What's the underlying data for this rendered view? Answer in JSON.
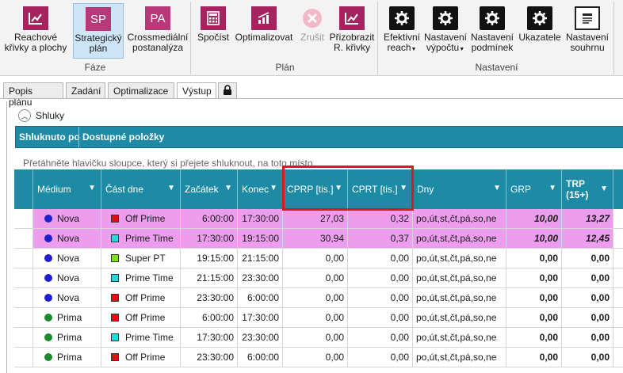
{
  "ribbon": {
    "groups": {
      "faze": {
        "label": "Fáze"
      },
      "plan": {
        "label": "Plán"
      },
      "nastaveni": {
        "label": "Nastavení"
      }
    },
    "buttons": [
      {
        "label1": "Reachové",
        "label2": "křivky a plochy",
        "icon": "chart-icon"
      },
      {
        "label1": "Strategický",
        "label2": "plán",
        "icon": "SP"
      },
      {
        "label1": "Crossmediální",
        "label2": "postanalýza",
        "icon": "PA"
      },
      {
        "label1": "Spočíst",
        "label2": "",
        "icon": "calculator-icon"
      },
      {
        "label1": "Optimalizovat",
        "label2": "",
        "icon": "optimize-chart-icon"
      },
      {
        "label1": "Zrušit",
        "label2": "",
        "icon": "cancel-icon"
      },
      {
        "label1": "Přizobrazit",
        "label2": "R. křivky",
        "icon": "curve-chart-icon"
      },
      {
        "label1": "Efektivní",
        "label2": "reach",
        "icon": "gear-icon"
      },
      {
        "label1": "Nastavení",
        "label2": "výpočtu",
        "icon": "gear-icon"
      },
      {
        "label1": "Nastavení",
        "label2": "podmínek",
        "icon": "gear-icon"
      },
      {
        "label1": "Ukazatele",
        "label2": "",
        "icon": "gear-icon"
      },
      {
        "label1": "Nastavení",
        "label2": "souhrnu",
        "icon": "document-icon"
      }
    ],
    "icon_text": {
      "sp": "SP",
      "pa": "PA"
    }
  },
  "tabs": [
    {
      "label": "Popis plánu"
    },
    {
      "label": "Zadání"
    },
    {
      "label": "Optimalizace"
    },
    {
      "label": "Výstup"
    }
  ],
  "shluky": {
    "label": "Shluky",
    "grouped_by": "Shluknuto po",
    "available": "Dostupné položky",
    "hint": "Přetáhněte hlavičku sloupce, který si přejete shluknout, na toto místo."
  },
  "columns": {
    "medium": "Médium",
    "cast_dne": "Část dne",
    "zacatek": "Začátek",
    "konec": "Konec",
    "cprp": "CPRP [tis.]",
    "cprt": "CPRT [tis.]",
    "dny": "Dny",
    "grp": "GRP",
    "trp1": "TRP",
    "trp2": "(15+)"
  },
  "colors": {
    "nova": "#1f1fd0",
    "prima": "#1a8a2a",
    "off_prime": "#e01010",
    "prime_time": "#20d8e0",
    "super_pt": "#80e020",
    "highlight": "#ec9ded"
  },
  "rows": [
    {
      "medium": "Nova",
      "mc": "#1f1fd0",
      "cast": "Off Prime",
      "cc": "#e01010",
      "start": "6:00:00",
      "end": "17:30:00",
      "cprp": "27,03",
      "cprt": "0,32",
      "dny": "po,út,st,čt,pá,so,ne",
      "grp": "10,00",
      "trp": "13,27",
      "pink": true
    },
    {
      "medium": "Nova",
      "mc": "#1f1fd0",
      "cast": "Prime Time",
      "cc": "#20d8e0",
      "start": "17:30:00",
      "end": "19:15:00",
      "cprp": "30,94",
      "cprt": "0,37",
      "dny": "po,út,st,čt,pá,so,ne",
      "grp": "10,00",
      "trp": "12,45",
      "pink": true
    },
    {
      "medium": "Nova",
      "mc": "#1f1fd0",
      "cast": "Super PT",
      "cc": "#80e020",
      "start": "19:15:00",
      "end": "21:15:00",
      "cprp": "0,00",
      "cprt": "0,00",
      "dny": "po,út,st,čt,pá,so,ne",
      "grp": "0,00",
      "trp": "0,00",
      "pink": false
    },
    {
      "medium": "Nova",
      "mc": "#1f1fd0",
      "cast": "Prime Time",
      "cc": "#20d8e0",
      "start": "21:15:00",
      "end": "23:30:00",
      "cprp": "0,00",
      "cprt": "0,00",
      "dny": "po,út,st,čt,pá,so,ne",
      "grp": "0,00",
      "trp": "0,00",
      "pink": false
    },
    {
      "medium": "Nova",
      "mc": "#1f1fd0",
      "cast": "Off Prime",
      "cc": "#e01010",
      "start": "23:30:00",
      "end": "6:00:00",
      "cprp": "0,00",
      "cprt": "0,00",
      "dny": "po,út,st,čt,pá,so,ne",
      "grp": "0,00",
      "trp": "0,00",
      "pink": false
    },
    {
      "medium": "Prima",
      "mc": "#1a8a2a",
      "cast": "Off Prime",
      "cc": "#e01010",
      "start": "6:00:00",
      "end": "17:30:00",
      "cprp": "0,00",
      "cprt": "0,00",
      "dny": "po,út,st,čt,pá,so,ne",
      "grp": "0,00",
      "trp": "0,00",
      "pink": false
    },
    {
      "medium": "Prima",
      "mc": "#1a8a2a",
      "cast": "Prime Time",
      "cc": "#20d8e0",
      "start": "17:30:00",
      "end": "23:30:00",
      "cprp": "0,00",
      "cprt": "0,00",
      "dny": "po,út,st,čt,pá,so,ne",
      "grp": "0,00",
      "trp": "0,00",
      "pink": false
    },
    {
      "medium": "Prima",
      "mc": "#1a8a2a",
      "cast": "Off Prime",
      "cc": "#e01010",
      "start": "23:30:00",
      "end": "6:00:00",
      "cprp": "0,00",
      "cprt": "0,00",
      "dny": "po,út,st,čt,pá,so,ne",
      "grp": "0,00",
      "trp": "0,00",
      "pink": false
    }
  ]
}
